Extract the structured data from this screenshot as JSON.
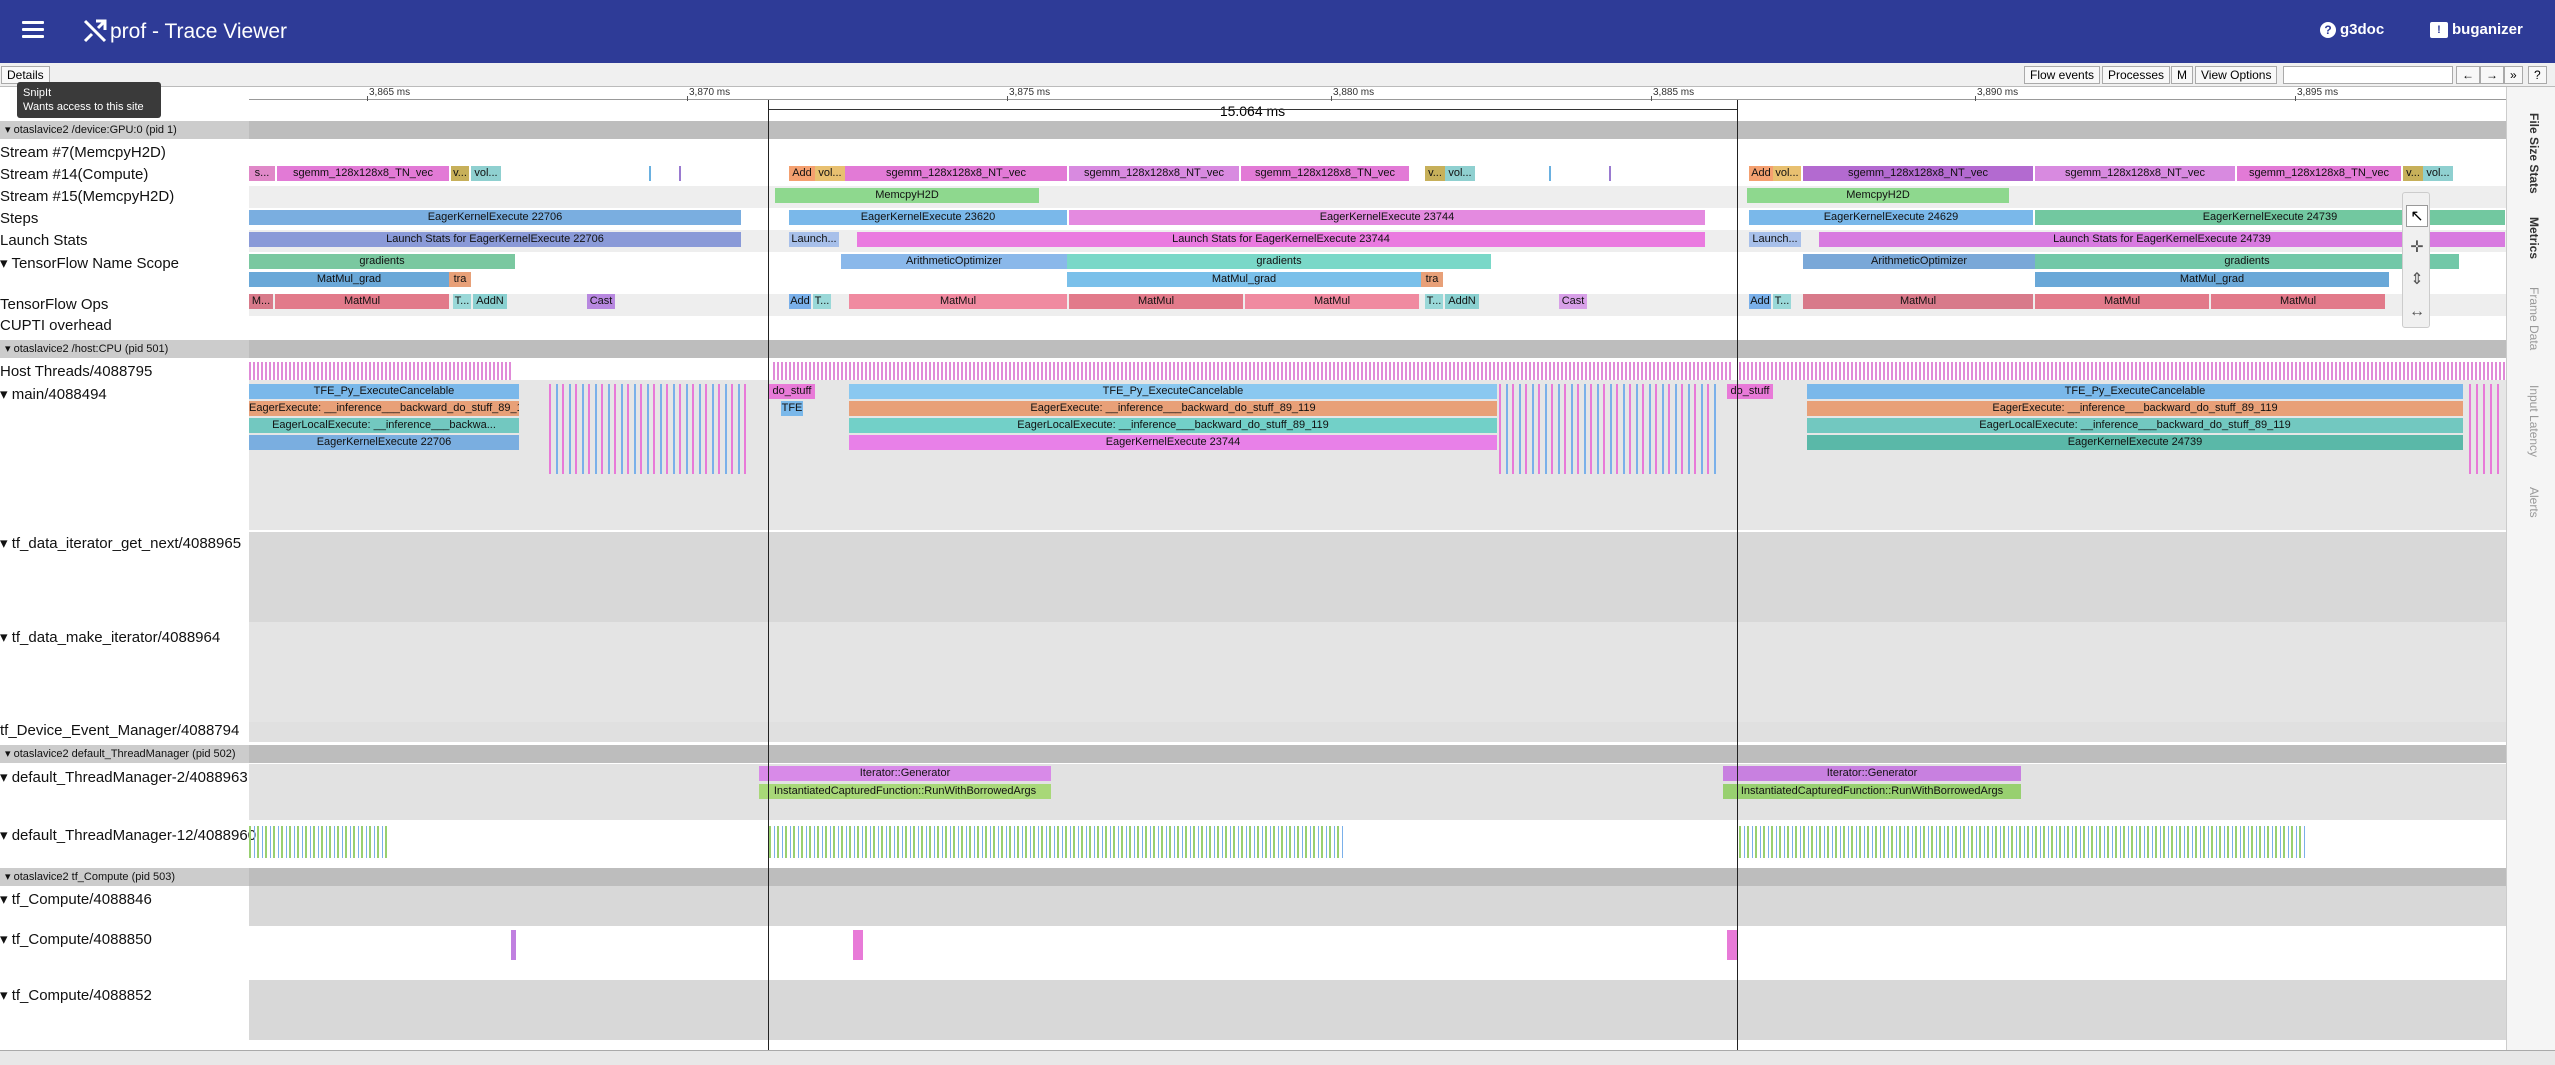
{
  "header": {
    "title": "prof - Trace Viewer",
    "link_g3doc": "g3doc",
    "link_buganizer": "buganizer"
  },
  "toolbar": {
    "details": "Details",
    "flow_events": "Flow events",
    "processes": "Processes",
    "m": "M",
    "view_options": "View Options",
    "prev": "←",
    "next": "→",
    "collapse": "»",
    "help": "?"
  },
  "tooltip": {
    "title": "SnipIt",
    "message": "Wants access to this site"
  },
  "ruler": {
    "ticks": [
      "3,865 ms",
      "3,870 ms",
      "3,875 ms",
      "3,880 ms",
      "3,885 ms",
      "3,890 ms",
      "3,895 ms"
    ]
  },
  "selection": {
    "duration": "15.064 ms"
  },
  "processes": {
    "gpu": "otaslavice2 /device:GPU:0 (pid 1)",
    "cpu": "otaslavice2 /host:CPU (pid 501)",
    "threadmanager": "otaslavice2 default_ThreadManager (pid 502)",
    "compute": "otaslavice2 tf_Compute (pid 503)",
    "close": "X"
  },
  "tracks": {
    "stream7": "Stream #7(MemcpyH2D)",
    "stream14": "Stream #14(Compute)",
    "stream15": "Stream #15(MemcpyH2D)",
    "steps": "Steps",
    "launch": "Launch Stats",
    "tfname": "TensorFlow Name Scope",
    "tfops": "TensorFlow Ops",
    "cupti": "CUPTI overhead",
    "host": "Host Threads/4088795",
    "main": "main/4088494",
    "iter_next": "tf_data_iterator_get_next/4088965",
    "make_iter": "tf_data_make_iterator/4088964",
    "dev_event": "tf_Device_Event_Manager/4088794",
    "tm2": "default_ThreadManager-2/4088963",
    "tm12": "default_ThreadManager-12/4088960",
    "comp846": "tf_Compute/4088846",
    "comp850": "tf_Compute/4088850",
    "comp852": "tf_Compute/4088852"
  },
  "labels": {
    "s": "s...",
    "sgemm_tn": "sgemm_128x128x8_TN_vec",
    "sgemm_nt": "sgemm_128x128x8_NT_vec",
    "v": "v...",
    "vol": "vol...",
    "add": "Add",
    "memcpy": "MemcpyH2D",
    "eager22706": "EagerKernelExecute 22706",
    "eager23620": "EagerKernelExecute 23620",
    "eager23744": "EagerKernelExecute 23744",
    "eager24629": "EagerKernelExecute 24629",
    "eager24739": "EagerKernelExecute 24739",
    "launch22706": "Launch Stats for EagerKernelExecute 22706",
    "launch_short": "Launch...",
    "launch23744": "Launch Stats for EagerKernelExecute 23744",
    "launch24739": "Launch Stats for EagerKernelExecute 24739",
    "gradients": "gradients",
    "matmul_grad": "MatMul_grad",
    "tra": "tra",
    "arith": "ArithmeticOptimizer",
    "matmul": "MatMul",
    "m": "M...",
    "t": "T...",
    "addn": "AddN",
    "cast": "Cast",
    "tfe_py": "TFE_Py_ExecuteCancelable",
    "eager_exec_short": "EagerExecute: __inference___backward_do_stuff_89_119",
    "eager_local_short": "EagerLocalExecute: __inference___backwa...",
    "eager_local": "EagerLocalExecute: __inference___backward_do_stuff_89_119",
    "do_stuff": "do_stuff",
    "tfe": "TFE",
    "iter_gen": "Iterator::Generator",
    "inst_func": "InstantiatedCapturedFunction::RunWithBorrowedArgs"
  },
  "sidebar_tabs": [
    "File Size Stats",
    "Metrics",
    "Frame Data",
    "Input Latency",
    "Alerts"
  ],
  "colors": {
    "header": "#2e3b97"
  }
}
